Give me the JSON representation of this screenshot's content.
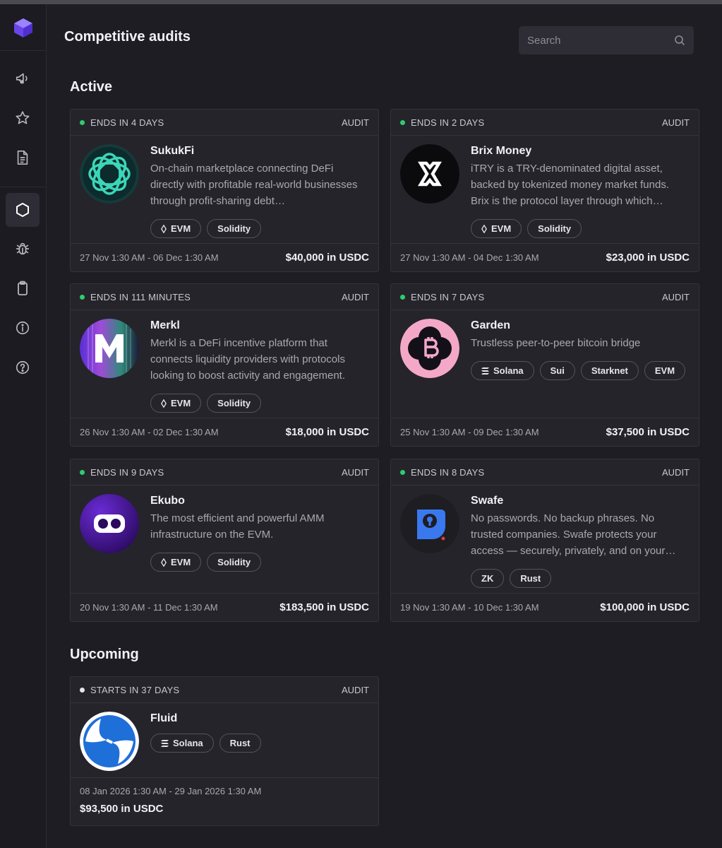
{
  "page": {
    "title": "Competitive audits"
  },
  "search": {
    "placeholder": "Search"
  },
  "sections": {
    "active": "Active",
    "upcoming": "Upcoming"
  },
  "sidebar": {
    "items": [
      {
        "icon": "megaphone-icon"
      },
      {
        "icon": "star-icon"
      },
      {
        "icon": "document-icon"
      },
      {
        "icon": "hexagon-icon",
        "active": true
      },
      {
        "icon": "bug-icon"
      },
      {
        "icon": "clipboard-icon"
      },
      {
        "icon": "info-icon"
      },
      {
        "icon": "help-icon"
      }
    ]
  },
  "audits": [
    {
      "status": "ENDS IN 4 DAYS",
      "type": "AUDIT",
      "name": "SukukFi",
      "description": "On-chain marketplace connecting DeFi directly with profitable real-world businesses through profit-sharing debt…",
      "tags": [
        {
          "label": "EVM",
          "icon": "ethereum-icon"
        },
        {
          "label": "Solidity"
        }
      ],
      "dates": "27 Nov 1:30 AM - 06 Dec 1:30 AM",
      "prize": "$40,000 in USDC"
    },
    {
      "status": "ENDS IN 2 DAYS",
      "type": "AUDIT",
      "name": "Brix Money",
      "description": "iTRY is a TRY-denominated digital asset, backed by tokenized money market funds. Brix is the protocol layer through which…",
      "tags": [
        {
          "label": "EVM",
          "icon": "ethereum-icon"
        },
        {
          "label": "Solidity"
        }
      ],
      "dates": "27 Nov 1:30 AM - 04 Dec 1:30 AM",
      "prize": "$23,000 in USDC"
    },
    {
      "status": "ENDS IN 111 MINUTES",
      "type": "AUDIT",
      "name": "Merkl",
      "description": "Merkl is a DeFi incentive platform that connects liquidity providers with protocols looking to boost activity and engagement.",
      "tags": [
        {
          "label": "EVM",
          "icon": "ethereum-icon"
        },
        {
          "label": "Solidity"
        }
      ],
      "dates": "26 Nov 1:30 AM - 02 Dec 1:30 AM",
      "prize": "$18,000 in USDC"
    },
    {
      "status": "ENDS IN 7 DAYS",
      "type": "AUDIT",
      "name": "Garden",
      "description": "Trustless peer-to-peer bitcoin bridge",
      "tags": [
        {
          "label": "Solana",
          "icon": "solana-icon"
        },
        {
          "label": "Sui"
        },
        {
          "label": "Starknet"
        },
        {
          "label": "EVM"
        }
      ],
      "dates": "25 Nov 1:30 AM - 09 Dec 1:30 AM",
      "prize": "$37,500 in USDC"
    },
    {
      "status": "ENDS IN 9 DAYS",
      "type": "AUDIT",
      "name": "Ekubo",
      "description": "The most efficient and powerful AMM infrastructure on the EVM.",
      "tags": [
        {
          "label": "EVM",
          "icon": "ethereum-icon"
        },
        {
          "label": "Solidity"
        }
      ],
      "dates": "20 Nov 1:30 AM - 11 Dec 1:30 AM",
      "prize": "$183,500 in USDC"
    },
    {
      "status": "ENDS IN 8 DAYS",
      "type": "AUDIT",
      "name": "Swafe",
      "description": "No passwords. No backup phrases. No trusted companies. Swafe protects your access — securely, privately, and on your…",
      "tags": [
        {
          "label": "ZK"
        },
        {
          "label": "Rust"
        }
      ],
      "dates": "19 Nov 1:30 AM - 10 Dec 1:30 AM",
      "prize": "$100,000 in USDC"
    }
  ],
  "upcoming": [
    {
      "status": "STARTS IN 37 DAYS",
      "type": "AUDIT",
      "name": "Fluid",
      "tags": [
        {
          "label": "Solana",
          "icon": "solana-icon"
        },
        {
          "label": "Rust"
        }
      ],
      "dates": "08 Jan 2026 1:30 AM - 29 Jan 2026 1:30 AM",
      "prize": "$93,500 in USDC"
    }
  ],
  "colors": {
    "active_dot": "#2ecc71",
    "upcoming_dot": "#e6e5ea",
    "brand": "#7b5cf5"
  }
}
